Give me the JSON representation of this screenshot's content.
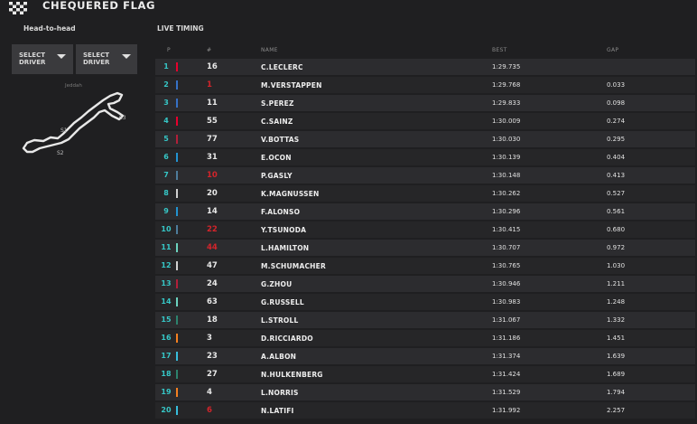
{
  "header": {
    "title": "CHEQUERED FLAG",
    "flag_icon": "chequered-flag-icon"
  },
  "sidebar": {
    "head_to_head_label": "Head-to-head",
    "select_driver_1": {
      "line1": "SELECT",
      "line2": "DRIVER"
    },
    "select_driver_2": {
      "line1": "SELECT",
      "line2": "DRIVER"
    },
    "track_name": "Jeddah",
    "sectors": [
      "S1",
      "S2",
      "S3"
    ]
  },
  "timing": {
    "label": "LIVE TIMING",
    "columns": {
      "pos": "P",
      "num": "#",
      "name": "NAME",
      "best": "BEST",
      "gap": "GAP"
    },
    "rows": [
      {
        "pos": "1",
        "team_color": "#e8002d",
        "num": "16",
        "num_red": false,
        "name": "C.LECLERC",
        "best": "1:29.735",
        "gap": ""
      },
      {
        "pos": "2",
        "team_color": "#3671c6",
        "num": "1",
        "num_red": true,
        "name": "M.VERSTAPPEN",
        "best": "1:29.768",
        "gap": "0.033"
      },
      {
        "pos": "3",
        "team_color": "#3671c6",
        "num": "11",
        "num_red": false,
        "name": "S.PEREZ",
        "best": "1:29.833",
        "gap": "0.098"
      },
      {
        "pos": "4",
        "team_color": "#e8002d",
        "num": "55",
        "num_red": false,
        "name": "C.SAINZ",
        "best": "1:30.009",
        "gap": "0.274"
      },
      {
        "pos": "5",
        "team_color": "#b12039",
        "num": "77",
        "num_red": false,
        "name": "V.BOTTAS",
        "best": "1:30.030",
        "gap": "0.295"
      },
      {
        "pos": "6",
        "team_color": "#2293d1",
        "num": "31",
        "num_red": false,
        "name": "E.OCON",
        "best": "1:30.139",
        "gap": "0.404"
      },
      {
        "pos": "7",
        "team_color": "#4e7c9b",
        "num": "10",
        "num_red": true,
        "name": "P.GASLY",
        "best": "1:30.148",
        "gap": "0.413"
      },
      {
        "pos": "8",
        "team_color": "#d0d0d0",
        "num": "20",
        "num_red": false,
        "name": "K.MAGNUSSEN",
        "best": "1:30.262",
        "gap": "0.527"
      },
      {
        "pos": "9",
        "team_color": "#2293d1",
        "num": "14",
        "num_red": false,
        "name": "F.ALONSO",
        "best": "1:30.296",
        "gap": "0.561"
      },
      {
        "pos": "10",
        "team_color": "#4e7c9b",
        "num": "22",
        "num_red": true,
        "name": "Y.TSUNODA",
        "best": "1:30.415",
        "gap": "0.680"
      },
      {
        "pos": "11",
        "team_color": "#6cd3bf",
        "num": "44",
        "num_red": true,
        "name": "L.HAMILTON",
        "best": "1:30.707",
        "gap": "0.972"
      },
      {
        "pos": "12",
        "team_color": "#d0d0d0",
        "num": "47",
        "num_red": false,
        "name": "M.SCHUMACHER",
        "best": "1:30.765",
        "gap": "1.030"
      },
      {
        "pos": "13",
        "team_color": "#b12039",
        "num": "24",
        "num_red": false,
        "name": "G.ZHOU",
        "best": "1:30.946",
        "gap": "1.211"
      },
      {
        "pos": "14",
        "team_color": "#6cd3bf",
        "num": "63",
        "num_red": false,
        "name": "G.RUSSELL",
        "best": "1:30.983",
        "gap": "1.248"
      },
      {
        "pos": "15",
        "team_color": "#2d826d",
        "num": "18",
        "num_red": false,
        "name": "L.STROLL",
        "best": "1:31.067",
        "gap": "1.332"
      },
      {
        "pos": "16",
        "team_color": "#f58020",
        "num": "3",
        "num_red": false,
        "name": "D.RICCIARDO",
        "best": "1:31.186",
        "gap": "1.451"
      },
      {
        "pos": "17",
        "team_color": "#37bedd",
        "num": "23",
        "num_red": false,
        "name": "A.ALBON",
        "best": "1:31.374",
        "gap": "1.639"
      },
      {
        "pos": "18",
        "team_color": "#2d826d",
        "num": "27",
        "num_red": false,
        "name": "N.HULKENBERG",
        "best": "1:31.424",
        "gap": "1.689"
      },
      {
        "pos": "19",
        "team_color": "#f58020",
        "num": "4",
        "num_red": false,
        "name": "L.NORRIS",
        "best": "1:31.529",
        "gap": "1.794"
      },
      {
        "pos": "20",
        "team_color": "#37bedd",
        "num": "6",
        "num_red": true,
        "name": "N.LATIFI",
        "best": "1:31.992",
        "gap": "2.257"
      }
    ]
  }
}
